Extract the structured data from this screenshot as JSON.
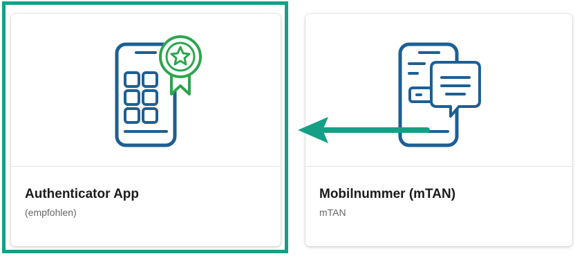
{
  "options": [
    {
      "title": "Authenticator App",
      "subtitle": "(empfohlen)",
      "icon": "authenticator-phone-with-award-icon",
      "selected": true
    },
    {
      "title": "Mobilnummer (mTAN)",
      "subtitle": "mTAN",
      "icon": "phone-with-sms-icon",
      "selected": false
    }
  ],
  "colors": {
    "icon_blue": "#1d5f93",
    "icon_green": "#2ea44f",
    "highlight": "#14a085",
    "arrow": "#14a085"
  }
}
